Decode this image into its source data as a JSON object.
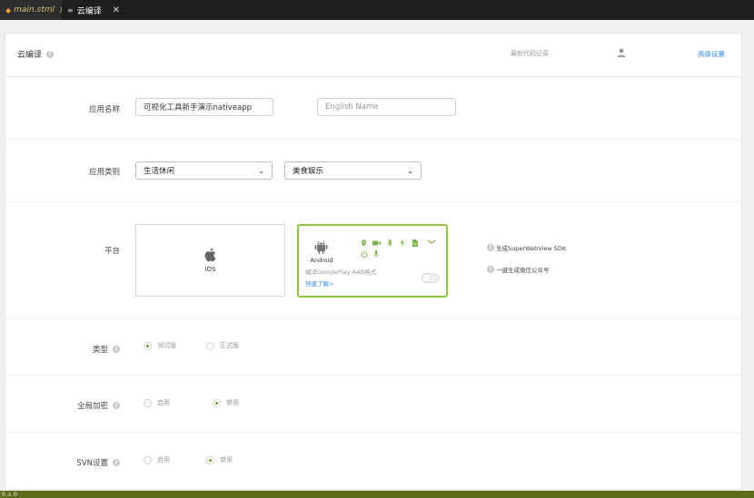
{
  "tabs": [
    {
      "label": "main.stml",
      "modified": "M"
    },
    {
      "label": "云编译",
      "close": "✕"
    }
  ],
  "header": {
    "title": "云编译",
    "latest_record": "最新代码记录",
    "advanced_settings": "高级设置"
  },
  "app_name": {
    "label": "应用名称",
    "value": "可视化工具新手演示nativeapp",
    "english_placeholder": "English Name"
  },
  "app_category": {
    "label": "应用类别",
    "primary": "生活休闲",
    "secondary": "美食娱乐"
  },
  "platform": {
    "label": "平台",
    "ios": "iOS",
    "android": "Android",
    "android_aab": "编译GooglePlay AAB格式",
    "android_learn_more": "快速了解>",
    "toggle_on": false,
    "option_sdk": "生成SuperWebView SDK",
    "option_wechat": "一键生成微信公众号"
  },
  "type": {
    "label": "类型",
    "options": [
      "测试版",
      "正式版"
    ],
    "selected": 0
  },
  "encryption": {
    "label": "全局加密",
    "options": [
      "启用",
      "禁用"
    ],
    "selected": 1
  },
  "svn": {
    "label": "SVN设置",
    "options": [
      "启用",
      "禁用"
    ],
    "selected": 1
  },
  "statusbar": {
    "text": "0 ⚠ 0"
  },
  "colors": {
    "accent_green": "#8cc63f",
    "link_blue": "#3a8ee6",
    "status_bar": "#5a6e1a"
  }
}
